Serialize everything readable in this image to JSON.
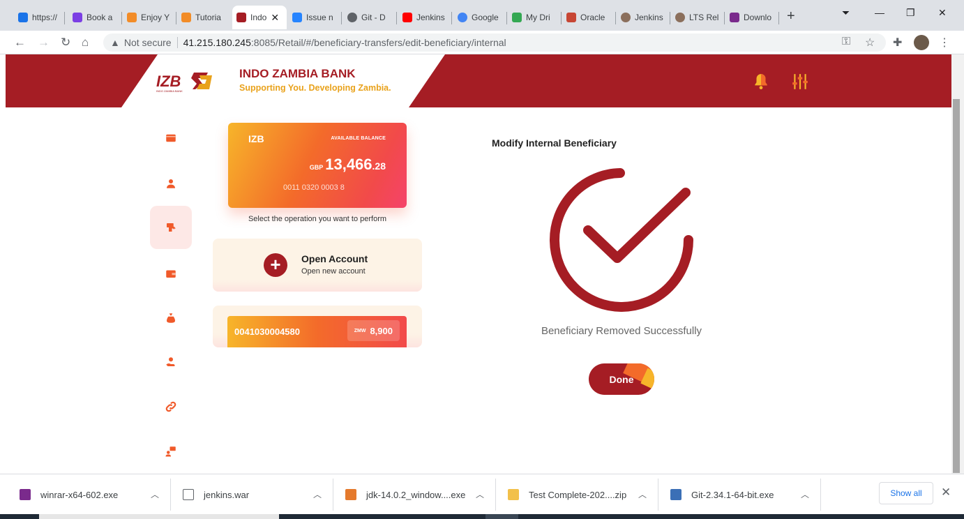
{
  "browser": {
    "tabs": [
      {
        "label": "https://",
        "color": "#1a73e8",
        "active": false
      },
      {
        "label": "Book a",
        "color": "#7b3fe4",
        "active": false
      },
      {
        "label": "Enjoy Y",
        "color": "#f28c28",
        "active": false
      },
      {
        "label": "Tutoria",
        "color": "#f28c28",
        "active": false
      },
      {
        "label": "Indo",
        "color": "#a51d24",
        "active": true
      },
      {
        "label": "Issue n",
        "color": "#2684ff",
        "active": false
      },
      {
        "label": "Git - D",
        "color": "#5f6368",
        "active": false
      },
      {
        "label": "Jenkins",
        "color": "#ff0000",
        "active": false
      },
      {
        "label": "Google",
        "color": "#4285f4",
        "active": false
      },
      {
        "label": "My Dri",
        "color": "#34a853",
        "active": false
      },
      {
        "label": "Oracle",
        "color": "#c74634",
        "active": false
      },
      {
        "label": "Jenkins",
        "color": "#8b6f5c",
        "active": false
      },
      {
        "label": "LTS Rel",
        "color": "#8b6f5c",
        "active": false
      },
      {
        "label": "Downlo",
        "color": "#7a2a8c",
        "active": false
      }
    ],
    "tab_close": "✕",
    "new_tab": "+",
    "security_label": "Not secure",
    "url_host": "41.215.180.245",
    "url_rest": ":8085/Retail/#/beneficiary-transfers/edit-beneficiary/internal"
  },
  "header": {
    "logo_text": "IZB",
    "logo_sub": "INDO ZAMBIA BANK",
    "bank_name": "INDO ZAMBIA BANK",
    "tagline": "Supporting You. Developing Zambia.",
    "accent": "#a51d24",
    "secondary": "#e9a21b"
  },
  "sidebar": {
    "items": [
      {
        "name": "card-icon"
      },
      {
        "name": "user-icon"
      },
      {
        "name": "transfer-icon",
        "active": true
      },
      {
        "name": "wallet-icon"
      },
      {
        "name": "money-bag-icon"
      },
      {
        "name": "hand-user-icon"
      },
      {
        "name": "link-icon"
      },
      {
        "name": "chat-user-icon"
      }
    ]
  },
  "balance_card": {
    "bank": "IZB",
    "label": "AVAILABLE BALANCE",
    "currency": "GBP",
    "amount_int": "13,466",
    "amount_dec": ".28",
    "account_number": "0011 0320 0003 8"
  },
  "operation_hint": "Select the operation you want to perform",
  "open_account": {
    "icon": "+",
    "title": "Open Account",
    "subtitle": "Open new account"
  },
  "account_row": {
    "number": "0041030004580",
    "currency": "ZMW",
    "balance": "8,900"
  },
  "result": {
    "title": "Modify Internal Beneficiary",
    "message": "Beneficiary Removed Successfully",
    "done_label": "Done"
  },
  "downloads": {
    "items": [
      {
        "name": "winrar-x64-602.exe"
      },
      {
        "name": "jenkins.war"
      },
      {
        "name": "jdk-14.0.2_window....exe"
      },
      {
        "name": "Test Complete-202....zip"
      },
      {
        "name": "Git-2.34.1-64-bit.exe"
      }
    ],
    "show_all": "Show all",
    "close": "✕"
  }
}
